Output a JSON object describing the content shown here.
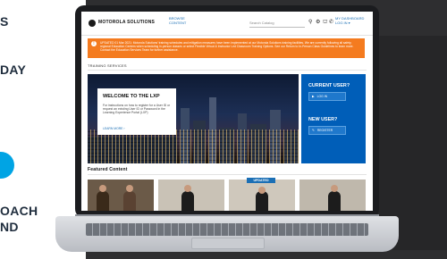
{
  "left_panel": {
    "lines": [
      "S",
      "DAY",
      "OACH",
      "ND"
    ]
  },
  "header": {
    "logo_text": "MOTOROLA SOLUTIONS",
    "browse_line1": "BROWSE",
    "browse_line2": "CONTENT",
    "search_placeholder": "Search Catalog",
    "icons": [
      "search-icon",
      "gear-icon",
      "cart-icon",
      "phone-icon"
    ],
    "dashboard_line1": "MY DASHBOARD",
    "dashboard_line2": "LOG IN ▾"
  },
  "banner": {
    "icon_glyph": "!",
    "text": "UPDATED 01 Mar 2021: Motorola Solutions' training schedules and mitigation measures have been implemented at our Motorola Solutions training facilities. We are currently following all safety, regional Education Centers when scheduling in-person classes or select Flexible Virtual & Instructor Led Classroom Training Options. See our Return to In-Person Class Guidelines to learn more. Contact the Education Services Team for further assistance."
  },
  "training_services_label": "TRAINING SERVICES",
  "hero": {
    "title": "WELCOME TO THE LXP",
    "body": "For instructions on how to register for a User ID or request an existing User ID or Password in the Learning Experience Portal (LXP)",
    "link": "LEARN MORE ›"
  },
  "side_box": {
    "current_user_title": "CURRENT USER?",
    "login_label": "LOG IN",
    "new_user_title": "NEW USER?",
    "register_label": "REGISTER"
  },
  "featured_label": "Featured Content",
  "featured_badge": "UPDATED",
  "colors": {
    "banner": "#f47b1f",
    "side_box": "#005eb8",
    "accent": "#1b6fb5"
  }
}
